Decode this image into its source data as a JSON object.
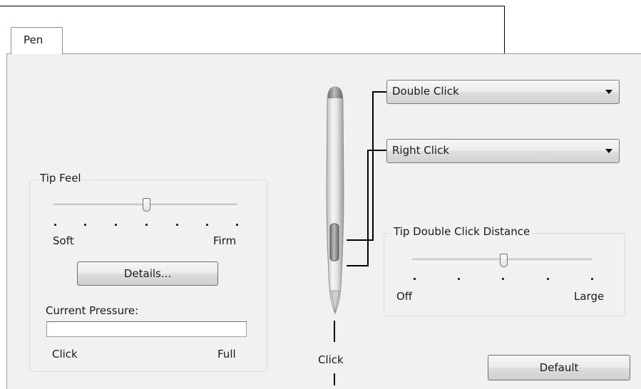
{
  "tab": {
    "label": "Pen"
  },
  "tip_feel": {
    "title": "Tip Feel",
    "min_label": "Soft",
    "max_label": "Firm",
    "level": 0.5,
    "details_button": "Details...",
    "current_pressure_label": "Current Pressure:",
    "pressure_value": 0,
    "pressure_min_label": "Click",
    "pressure_max_label": "Full"
  },
  "pen": {
    "upper_button": {
      "selected": "Double Click"
    },
    "lower_button": {
      "selected": "Right Click"
    },
    "tip_label": "Click"
  },
  "tip_double_click_distance": {
    "title": "Tip Double Click Distance",
    "min_label": "Off",
    "max_label": "Large",
    "level": 0.5
  },
  "default_button": "Default",
  "icons": {
    "pen": "pen-illustration-icon",
    "dropdown": "chevron-down-icon",
    "slider_thumb": "slider-thumb-icon"
  }
}
